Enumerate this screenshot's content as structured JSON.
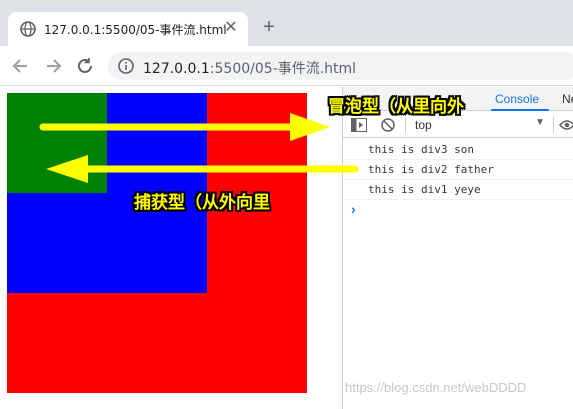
{
  "browser": {
    "tab_title": "127.0.0.1:5500/05-事件流.html",
    "tab_close": "✕",
    "new_tab": "+",
    "url_host": "127.0.0.1",
    "url_path": ":5500/05-事件流.html"
  },
  "page": {
    "boxes": [
      {
        "name": "div1",
        "color": "#ff0000"
      },
      {
        "name": "div2",
        "color": "#0000ff"
      },
      {
        "name": "div3",
        "color": "#008000"
      }
    ]
  },
  "devtools": {
    "tab_console": "Console",
    "tab_next": "Ne",
    "context": "top",
    "logs": [
      "this is div3 son",
      "this is div2 father",
      "this is div1 yeye"
    ],
    "prompt": "›"
  },
  "annotations": {
    "bubbling": "冒泡型（从里向外",
    "capturing": "捕获型（从外向里",
    "arrow_color": "#ffff00"
  },
  "watermark": "https://blog.csdn.net/webDDDD"
}
